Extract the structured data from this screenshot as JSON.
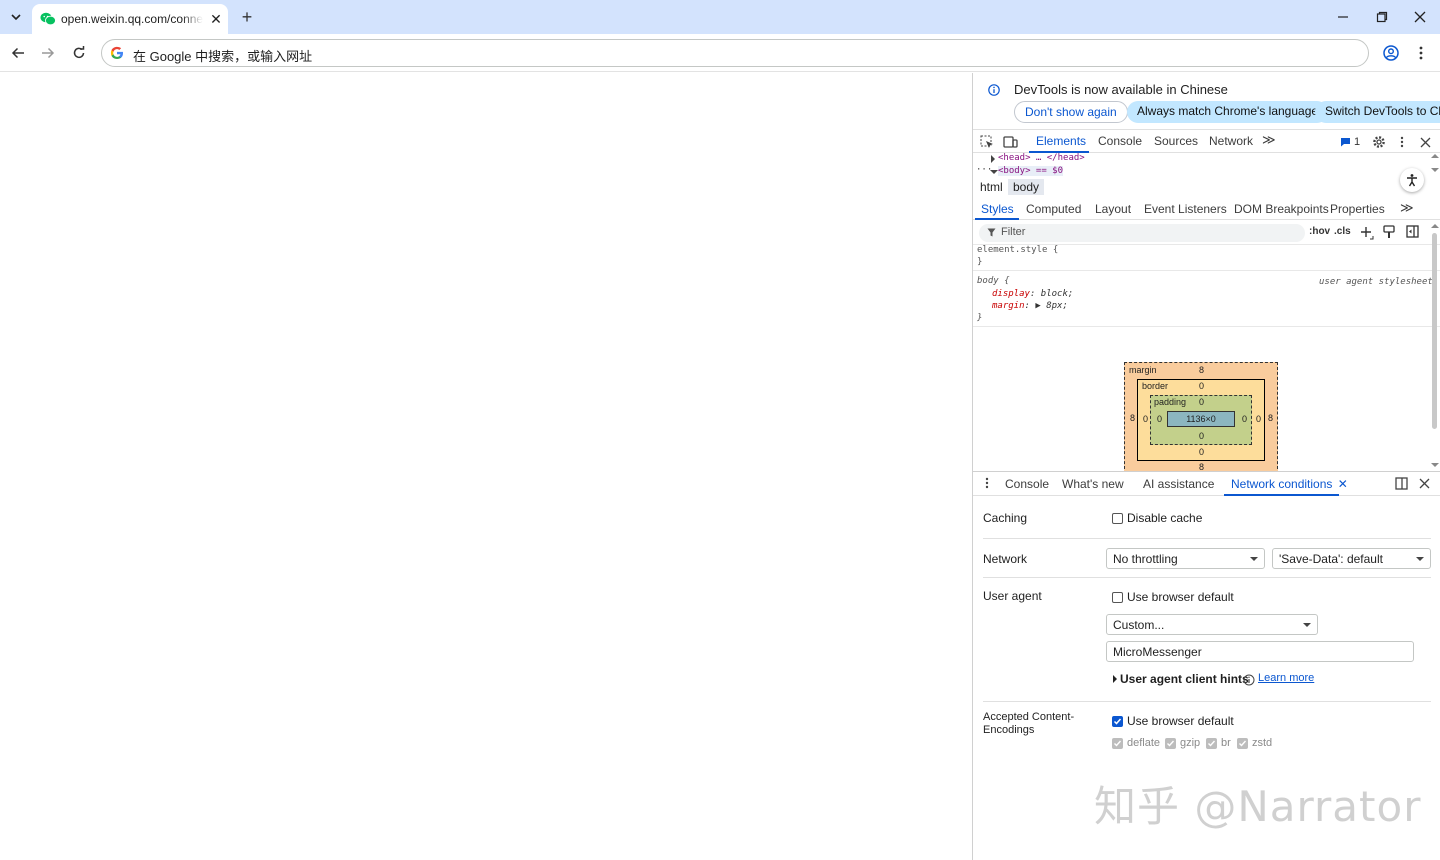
{
  "browser": {
    "tab": {
      "title": "open.weixin.qq.com/connect",
      "close_glyph": "✕"
    },
    "new_tab_glyph": "+",
    "window": {
      "minimize": "—",
      "maximize": "❐",
      "close": "✕"
    },
    "omnibox": {
      "placeholder": "在 Google 中搜索，或输入网址"
    },
    "colors": {
      "tabstrip": "#d3e3fd",
      "accent": "#0b57d0",
      "favicon": "#07c160"
    }
  },
  "devtools": {
    "infobar": {
      "message": "DevTools is now available in Chinese",
      "dont_show": "Don't show again",
      "always_match": "Always match Chrome's language",
      "switch": "Switch DevTools to Chin"
    },
    "main_tabs": [
      "Elements",
      "Console",
      "Sources",
      "Network"
    ],
    "more_tabs": "≫",
    "issues_count": "1",
    "dom": {
      "head_line": "<head> … </head>",
      "body_line": "<body> == $0",
      "ellipsis": "···"
    },
    "breadcrumbs": [
      "html",
      "body"
    ],
    "styles_tabs": [
      "Styles",
      "Computed",
      "Layout",
      "Event Listeners",
      "DOM Breakpoints",
      "Properties"
    ],
    "filter": {
      "placeholder": "Filter",
      "hov": ":hov",
      "cls": ".cls"
    },
    "rules": {
      "element_style": "element.style {",
      "close_brace": "}",
      "body_selector": "body {",
      "source": "user agent stylesheet",
      "display_prop": "display",
      "display_val": "block;",
      "margin_prop": "margin",
      "margin_val": "8px;"
    },
    "box_model": {
      "margin_label": "margin",
      "margin_top": "8",
      "margin_bottom": "8",
      "margin_left": "8",
      "margin_right": "8",
      "border_label": "border",
      "border_top": "0",
      "border_bottom": "0",
      "border_left": "0",
      "border_right": "0",
      "padding_label": "padding",
      "padding_top": "0",
      "padding_bottom": "0",
      "padding_left": "0",
      "padding_right": "0",
      "content": "1136×0"
    },
    "drawer_tabs": [
      "Console",
      "What's new",
      "AI assistance"
    ],
    "drawer_active": "Network conditions",
    "drawer_active_close": "✕",
    "network_conditions": {
      "caching_label": "Caching",
      "disable_cache": "Disable cache",
      "network_label": "Network",
      "throttling": "No throttling",
      "save_data": "'Save-Data': default",
      "user_agent_label": "User agent",
      "use_browser_default": "Use browser default",
      "ua_select": "Custom...",
      "ua_value": "MicroMessenger",
      "client_hints": "User agent client hints",
      "learn_more": "Learn more",
      "encodings_label_1": "Accepted Content-",
      "encodings_label_2": "Encodings",
      "encodings_default": "Use browser default",
      "encodings": [
        "deflate",
        "gzip",
        "br",
        "zstd"
      ]
    }
  },
  "watermark": "知乎 @Narrator"
}
